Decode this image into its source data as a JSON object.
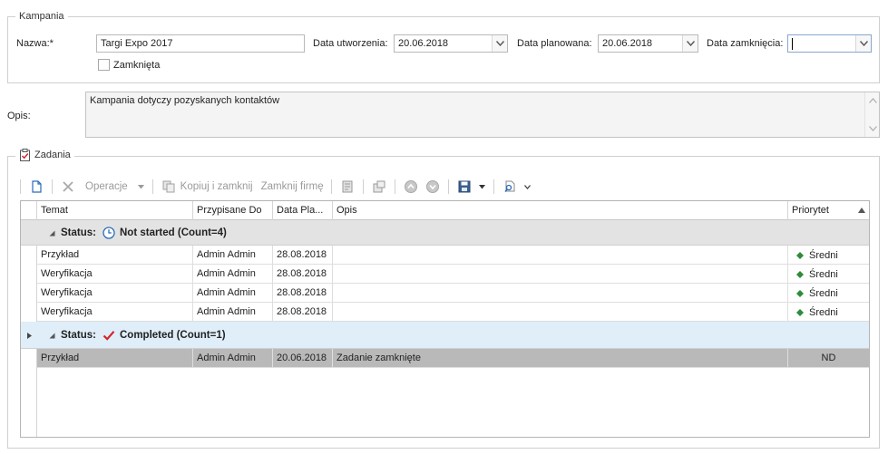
{
  "kampania": {
    "legend": "Kampania",
    "nazwa_label": "Nazwa:*",
    "nazwa_value": "Targi Expo 2017",
    "data_utworzenia_label": "Data utworzenia:",
    "data_utworzenia_value": "20.06.2018",
    "data_planowana_label": "Data planowana:",
    "data_planowana_value": "20.06.2018",
    "data_zamkniecia_label": "Data zamknięcia:",
    "data_zamkniecia_value": "",
    "zamknieta_label": "Zamknięta",
    "zamknieta_checked": false
  },
  "opis": {
    "label": "Opis:",
    "value": "Kampania dotyczy pozyskanych kontaktów"
  },
  "zadania": {
    "legend": "Zadania",
    "legend_icon": "clipboard-check-icon",
    "toolbar": {
      "new_icon": "new-document-icon",
      "delete_icon": "delete-x-icon",
      "operacje_label": "Operacje",
      "copy_icon": "copy-icon",
      "kopiuj_label": "Kopiuj i zamknij",
      "zamknij_firme_label": "Zamknij firmę",
      "icons": [
        "print-icon",
        "window-icon",
        "move-up-icon",
        "move-down-icon",
        "save-icon",
        "search-document-icon"
      ]
    },
    "columns": [
      "Temat",
      "Przypisane Do",
      "Data Pla...",
      "Opis",
      "Priorytet"
    ],
    "groups": [
      {
        "status_label": "Status:",
        "status_icon": "clock-icon",
        "status_text": "Not started (Count=4)",
        "expanded": true,
        "rows": [
          {
            "temat": "Przykład",
            "przypisane": "Admin Admin",
            "data": "28.08.2018",
            "opis": "",
            "priorytet": "Średni"
          },
          {
            "temat": "Weryfikacja",
            "przypisane": "Admin Admin",
            "data": "28.08.2018",
            "opis": "",
            "priorytet": "Średni"
          },
          {
            "temat": "Weryfikacja",
            "przypisane": "Admin Admin",
            "data": "28.08.2018",
            "opis": "",
            "priorytet": "Średni"
          },
          {
            "temat": "Weryfikacja",
            "przypisane": "Admin Admin",
            "data": "28.08.2018",
            "opis": "",
            "priorytet": "Średni"
          }
        ]
      },
      {
        "status_label": "Status:",
        "status_icon": "checkmark-icon",
        "status_text": "Completed (Count=1)",
        "expanded": true,
        "rows": [
          {
            "temat": "Przykład",
            "przypisane": "Admin Admin",
            "data": "20.06.2018",
            "opis": "Zadanie zamknięte",
            "priorytet": "ND"
          }
        ]
      }
    ]
  },
  "colors": {
    "priority_dot": "#2e8b3a",
    "completed_check": "#d0262b",
    "selected_row": "#b9b9b9",
    "focused_group": "#dfeef8"
  }
}
